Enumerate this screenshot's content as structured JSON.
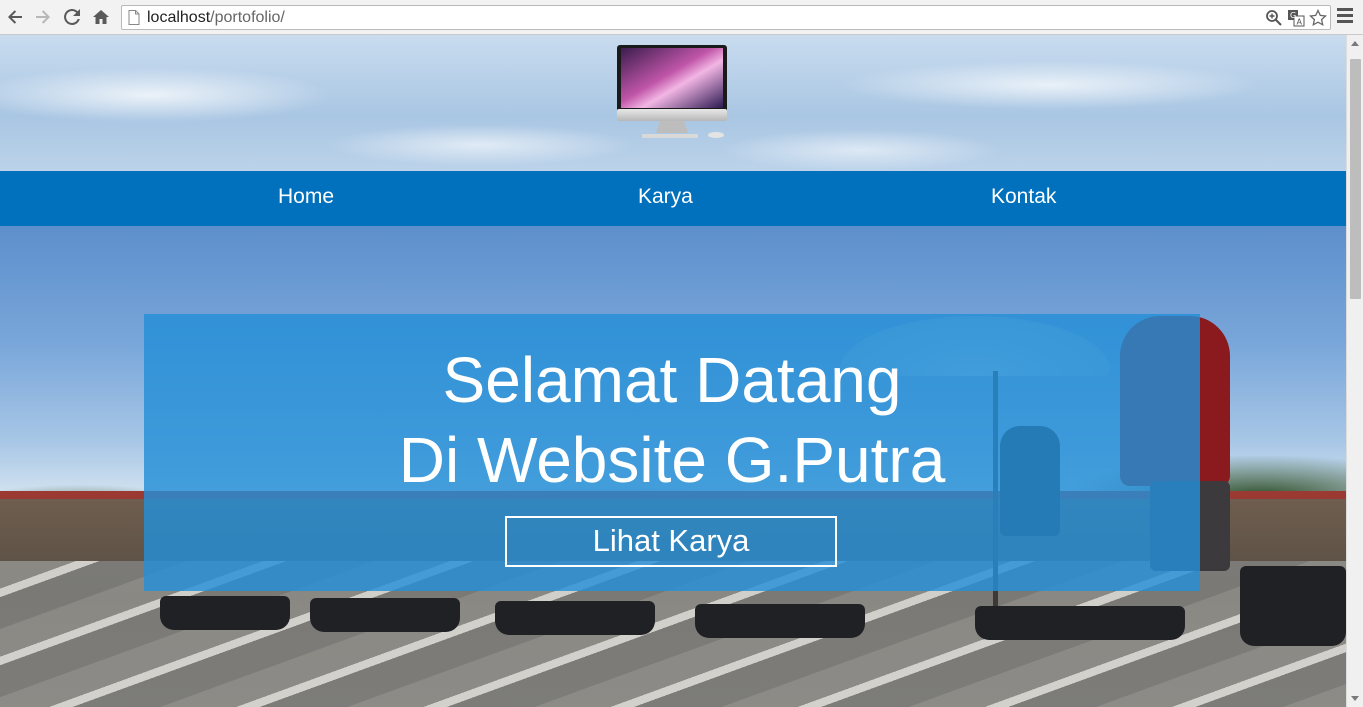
{
  "browser": {
    "url_host": "localhost",
    "url_path": "/portofolio/",
    "icons": [
      "back-icon",
      "forward-icon",
      "reload-icon",
      "home-icon",
      "page-icon",
      "zoom-icon",
      "translate-icon",
      "bookmark-star-icon",
      "chrome-menu-icon"
    ]
  },
  "site": {
    "logo": "imac-icon",
    "nav": [
      {
        "label": "Home"
      },
      {
        "label": "Karya"
      },
      {
        "label": "Kontak"
      }
    ],
    "hero": {
      "title_line1": "Selamat Datang",
      "title_line2": "Di Website G.Putra",
      "button_label": "Lihat Karya"
    }
  },
  "colors": {
    "nav_bg": "#0271bd",
    "hero_panel": "#258fd7",
    "text": "#ffffff"
  }
}
